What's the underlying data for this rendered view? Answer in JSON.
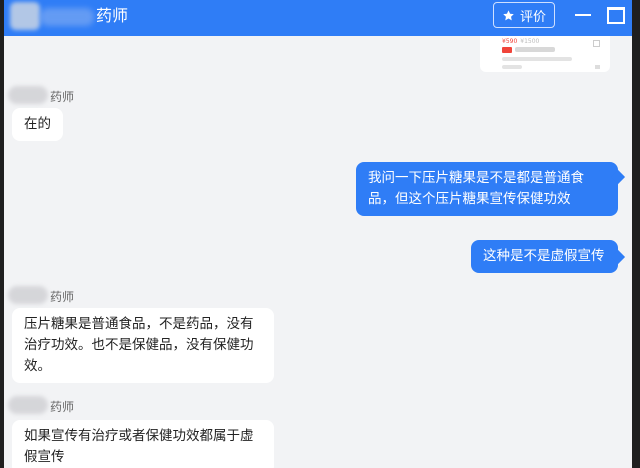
{
  "header": {
    "title": "药师",
    "rate_label": "评价"
  },
  "product_card": {
    "price": "¥590",
    "old_price": "¥1500"
  },
  "messages": [
    {
      "from": "pharmacist",
      "sender": "药师",
      "text": "在的"
    },
    {
      "from": "user",
      "text": "我问一下压片糖果是不是都是普通食品，但这个压片糖果宣传保健功效"
    },
    {
      "from": "user",
      "text": "这种是不是虚假宣传"
    },
    {
      "from": "pharmacist",
      "sender": "药师",
      "text": "压片糖果是普通食品，不是药品，没有治疗功效。也不是保健品，没有保健功效。"
    },
    {
      "from": "pharmacist",
      "sender": "药师",
      "text": "如果宣传有治疗或者保健功效都属于虚假宣传"
    }
  ],
  "colors": {
    "accent": "#2f7df6",
    "chat_bg": "#f2f3f5",
    "incoming_bubble": "#ffffff"
  }
}
